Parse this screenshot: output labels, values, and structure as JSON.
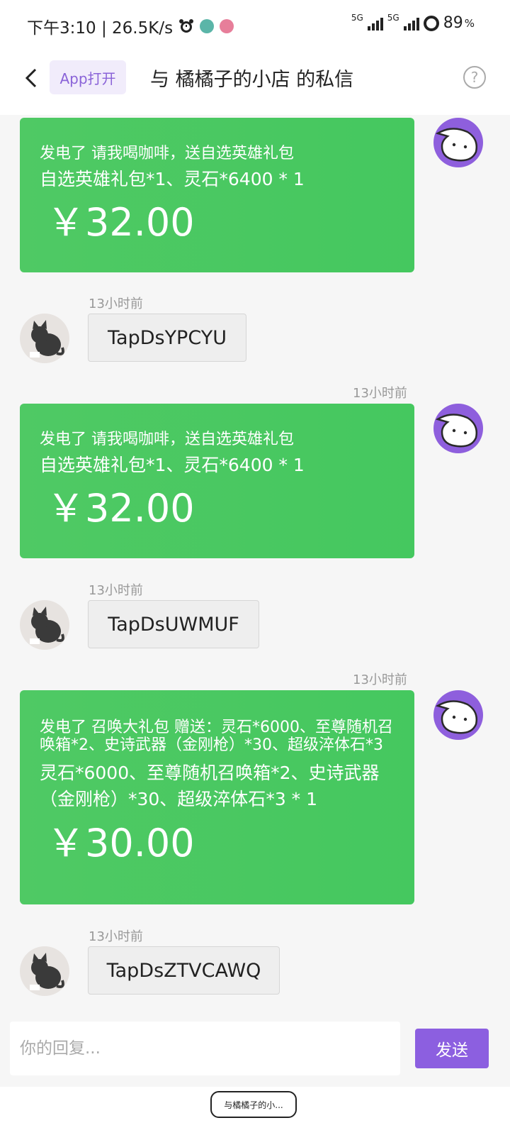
{
  "status_bar": {
    "time_speed": "下午3:10 | 26.5K/s",
    "signal1": "5G",
    "signal2": "5G",
    "battery": "89",
    "battery_unit": "%"
  },
  "header": {
    "app_open_label": "App打开",
    "title": "与 橘橘子的小店 的私信"
  },
  "messages": [
    {
      "type": "order",
      "side": "right",
      "time": "",
      "title": "发电了 请我喝咖啡，送自选英雄礼包",
      "detail": "自选英雄礼包*1、灵石*6400 * 1",
      "price": "￥32.00"
    },
    {
      "type": "code",
      "side": "left",
      "time": "13小时前",
      "code": "TapDsYPCYU"
    },
    {
      "type": "order",
      "side": "right",
      "time": "13小时前",
      "title": "发电了 请我喝咖啡，送自选英雄礼包",
      "detail": "自选英雄礼包*1、灵石*6400 * 1",
      "price": "￥32.00"
    },
    {
      "type": "code",
      "side": "left",
      "time": "13小时前",
      "code": "TapDsUWMUF"
    },
    {
      "type": "order",
      "side": "right",
      "time": "13小时前",
      "title": "发电了 召唤大礼包 赠送：灵石*6000、至尊随机召唤箱*2、史诗武器（金刚枪）*30、超级淬体石*3",
      "detail": "灵石*6000、至尊随机召唤箱*2、史诗武器（金刚枪）*30、超级淬体石*3 * 1",
      "price": "￥30.00"
    },
    {
      "type": "code",
      "side": "left",
      "time": "13小时前",
      "code": "TapDsZTVCAWQ"
    }
  ],
  "input": {
    "placeholder": "你的回复...",
    "send_label": "发送"
  },
  "bottom_tab": {
    "label": "与橘橘子的小..."
  },
  "colors": {
    "card_green": "#4cc962",
    "accent_purple": "#8c5fe0",
    "bot_avatar": "#8e5fdd"
  }
}
